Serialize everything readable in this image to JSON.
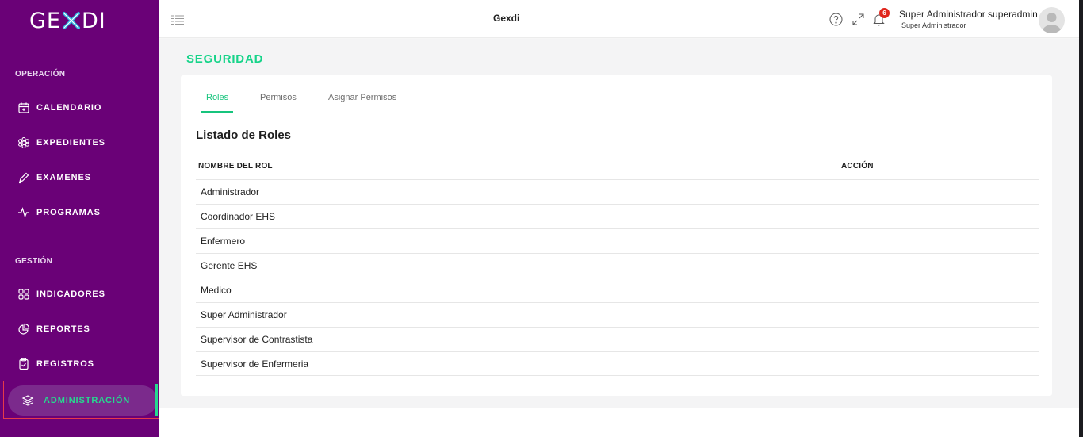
{
  "brand": {
    "logo_left": "GE",
    "logo_right": "DI",
    "accent": "#26d98f",
    "sidebar_bg": "#6a0177"
  },
  "sidebar": {
    "section_operacion": "OPERACIÓN",
    "section_gestion": "GESTIÓN",
    "items": [
      {
        "label": "CALENDARIO",
        "icon": "calendar-icon"
      },
      {
        "label": "EXPEDIENTES",
        "icon": "flower-icon"
      },
      {
        "label": "EXAMENES",
        "icon": "pen-icon"
      },
      {
        "label": "PROGRAMAS",
        "icon": "pulse-icon"
      },
      {
        "label": "INDICADORES",
        "icon": "grid-icon"
      },
      {
        "label": "REPORTES",
        "icon": "pie-chart-icon"
      },
      {
        "label": "REGISTROS",
        "icon": "clipboard-icon"
      },
      {
        "label": "ADMINISTRACIÓN",
        "icon": "layers-icon",
        "active": true
      }
    ]
  },
  "header": {
    "title": "Gexdi",
    "notification_count": "6",
    "user_name": "Super Administrador superadmin",
    "user_role": "Super Administrador"
  },
  "page": {
    "title": "SEGURIDAD",
    "tabs": [
      {
        "label": "Roles",
        "active": true
      },
      {
        "label": "Permisos"
      },
      {
        "label": "Asignar Permisos"
      }
    ],
    "list_title": "Listado de Roles",
    "columns": {
      "name": "NOMBRE DEL ROL",
      "action": "ACCIÓN"
    },
    "roles": [
      "Administrador",
      "Coordinador EHS",
      "Enfermero",
      "Gerente EHS",
      "Medico",
      "Super Administrador",
      "Supervisor de Contrastista",
      "Supervisor de Enfermeria"
    ]
  }
}
